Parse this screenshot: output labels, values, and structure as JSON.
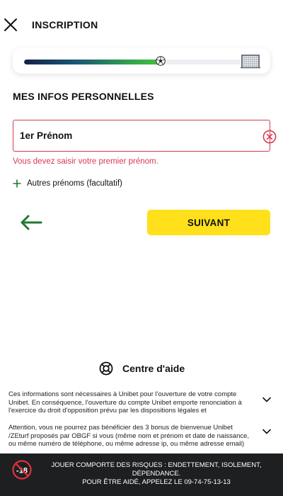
{
  "header": {
    "title": "INSCRIPTION",
    "close_icon": "close-icon"
  },
  "progress": {
    "value": 0.63,
    "ball_icon": "soccer-ball-icon",
    "goal_icon": "goal-net-icon",
    "fill_colors": [
      "#14214a",
      "#33a74a",
      "#45c040"
    ]
  },
  "section": {
    "title": "MES INFOS PERSONNELLES"
  },
  "first_name": {
    "value": "1er Prénom",
    "error": "Vous devez saisir votre premier prénom.",
    "clear_icon": "clear-circle-x-icon",
    "error_color": "#d63a52"
  },
  "other_names": {
    "label": "Autres prénoms (facultatif)",
    "icon": "plus-icon"
  },
  "nav": {
    "back_icon": "arrow-left-icon",
    "next_label": "SUIVANT",
    "accent": "#ffe01b"
  },
  "help": {
    "label": "Centre d'aide",
    "icon": "lifebuoy-icon"
  },
  "info": [
    {
      "text": "Ces informations sont nécessaires à Unibet pour l'ouverture de votre compte Unibet. En conséquence, l'ouverture du compte Unibet emporte renonciation à l'exercice du droit d'opposition prévu par les dispositions légales et réglementaires"
    },
    {
      "text": "Attention, vous ne pourrez pas bénéficier des 3 bonus de bienvenue Unibet /ZEturf proposés par OBGF si vous (même nom et prénom et date de naissance, ou même numéro de téléphone, ou même adresse ip, ou même adresse email) ou une"
    }
  ],
  "footer": {
    "age_badge": "-18",
    "line1": "JOUER COMPORTE DES RISQUES : ENDETTEMENT, ISOLEMENT, DÉPENDANCE.",
    "line2": "POUR ÊTRE AIDÉ, APPELEZ LE 09-74-75-13-13"
  }
}
